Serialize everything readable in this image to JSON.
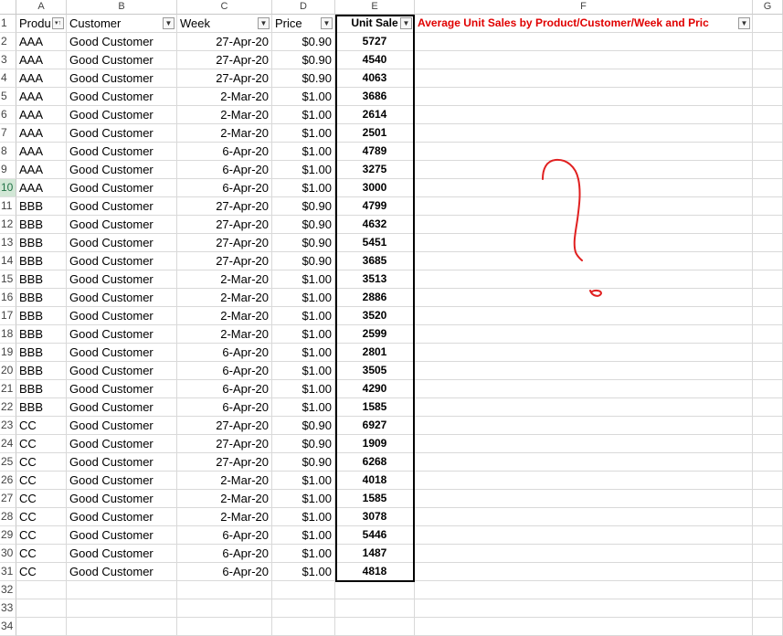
{
  "columns": [
    "A",
    "B",
    "C",
    "D",
    "E",
    "F",
    "G"
  ],
  "headers": {
    "product": "Produ",
    "customer": "Customer",
    "week": "Week",
    "price": "Price",
    "unit_sales": "Unit Sale",
    "note": "Average Unit Sales by Product/Customer/Week and Pric"
  },
  "rows": [
    [
      "AAA",
      "Good Customer",
      "27-Apr-20",
      "$0.90",
      "5727"
    ],
    [
      "AAA",
      "Good Customer",
      "27-Apr-20",
      "$0.90",
      "4540"
    ],
    [
      "AAA",
      "Good Customer",
      "27-Apr-20",
      "$0.90",
      "4063"
    ],
    [
      "AAA",
      "Good Customer",
      "2-Mar-20",
      "$1.00",
      "3686"
    ],
    [
      "AAA",
      "Good Customer",
      "2-Mar-20",
      "$1.00",
      "2614"
    ],
    [
      "AAA",
      "Good Customer",
      "2-Mar-20",
      "$1.00",
      "2501"
    ],
    [
      "AAA",
      "Good Customer",
      "6-Apr-20",
      "$1.00",
      "4789"
    ],
    [
      "AAA",
      "Good Customer",
      "6-Apr-20",
      "$1.00",
      "3275"
    ],
    [
      "AAA",
      "Good Customer",
      "6-Apr-20",
      "$1.00",
      "3000"
    ],
    [
      "BBB",
      "Good Customer",
      "27-Apr-20",
      "$0.90",
      "4799"
    ],
    [
      "BBB",
      "Good Customer",
      "27-Apr-20",
      "$0.90",
      "4632"
    ],
    [
      "BBB",
      "Good Customer",
      "27-Apr-20",
      "$0.90",
      "5451"
    ],
    [
      "BBB",
      "Good Customer",
      "27-Apr-20",
      "$0.90",
      "3685"
    ],
    [
      "BBB",
      "Good Customer",
      "2-Mar-20",
      "$1.00",
      "3513"
    ],
    [
      "BBB",
      "Good Customer",
      "2-Mar-20",
      "$1.00",
      "2886"
    ],
    [
      "BBB",
      "Good Customer",
      "2-Mar-20",
      "$1.00",
      "3520"
    ],
    [
      "BBB",
      "Good Customer",
      "2-Mar-20",
      "$1.00",
      "2599"
    ],
    [
      "BBB",
      "Good Customer",
      "6-Apr-20",
      "$1.00",
      "2801"
    ],
    [
      "BBB",
      "Good Customer",
      "6-Apr-20",
      "$1.00",
      "3505"
    ],
    [
      "BBB",
      "Good Customer",
      "6-Apr-20",
      "$1.00",
      "4290"
    ],
    [
      "BBB",
      "Good Customer",
      "6-Apr-20",
      "$1.00",
      "1585"
    ],
    [
      "CC",
      "Good Customer",
      "27-Apr-20",
      "$0.90",
      "6927"
    ],
    [
      "CC",
      "Good Customer",
      "27-Apr-20",
      "$0.90",
      "1909"
    ],
    [
      "CC",
      "Good Customer",
      "27-Apr-20",
      "$0.90",
      "6268"
    ],
    [
      "CC",
      "Good Customer",
      "2-Mar-20",
      "$1.00",
      "4018"
    ],
    [
      "CC",
      "Good Customer",
      "2-Mar-20",
      "$1.00",
      "1585"
    ],
    [
      "CC",
      "Good Customer",
      "2-Mar-20",
      "$1.00",
      "3078"
    ],
    [
      "CC",
      "Good Customer",
      "6-Apr-20",
      "$1.00",
      "5446"
    ],
    [
      "CC",
      "Good Customer",
      "6-Apr-20",
      "$1.00",
      "1487"
    ],
    [
      "CC",
      "Good Customer",
      "6-Apr-20",
      "$1.00",
      "4818"
    ]
  ],
  "extra_row_numbers": [
    "32",
    "33",
    "34"
  ],
  "selected_row": "10",
  "colors": {
    "note_red": "#e00000",
    "row_select": "#d2e7d6",
    "grid": "#d9d9d9",
    "scribble": "#e02020"
  },
  "icons": {
    "filter_sort": "filter-sort-dropdown-icon",
    "filter": "filter-dropdown-icon"
  }
}
